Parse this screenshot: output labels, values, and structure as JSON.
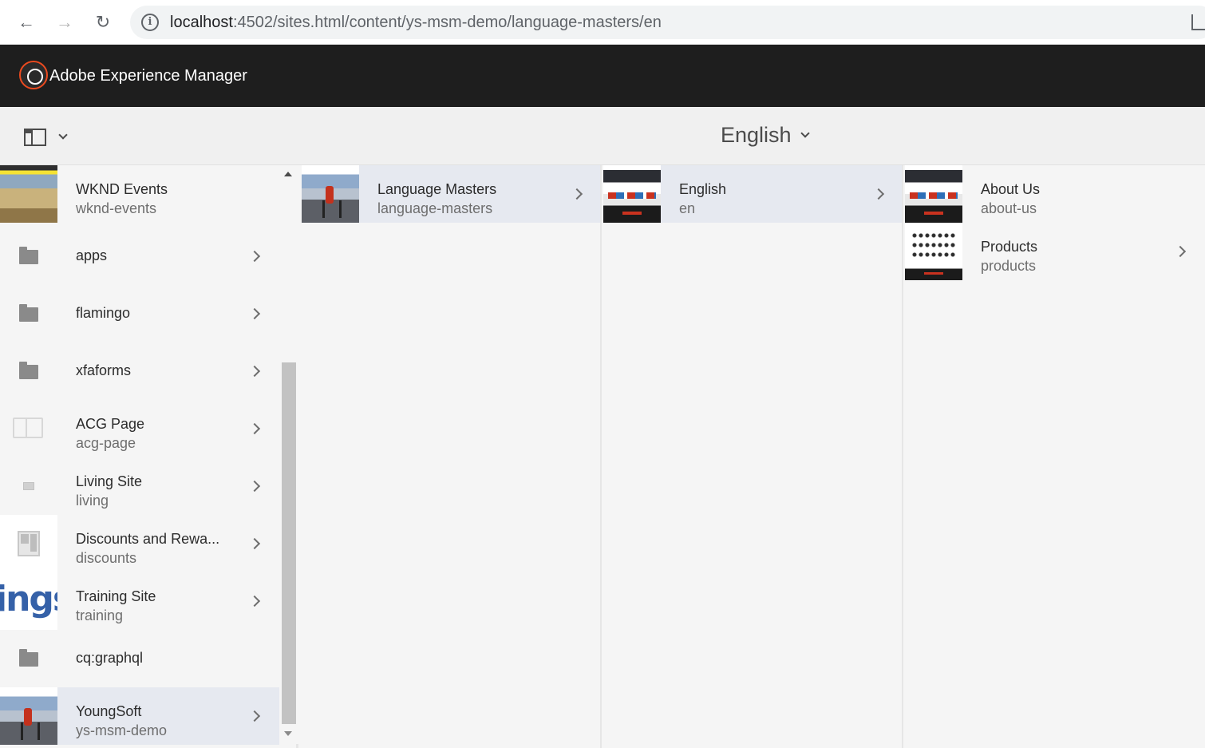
{
  "browser": {
    "back_icon": "arrow-left-icon",
    "forward_icon": "arrow-right-icon",
    "reload_icon": "reload-icon",
    "url_host": "localhost",
    "url_path": ":4502/sites.html/content/ys-msm-demo/language-masters/en"
  },
  "header": {
    "app_title": "Adobe Experience Manager"
  },
  "toolbar": {
    "title": "English"
  },
  "columns": [
    {
      "items": [
        {
          "title": "WKND Events",
          "name": "wknd-events"
        },
        {
          "title": "apps",
          "name": ""
        },
        {
          "title": "flamingo",
          "name": ""
        },
        {
          "title": "xfaforms",
          "name": ""
        },
        {
          "title": "ACG Page",
          "name": "acg-page"
        },
        {
          "title": "Living Site",
          "name": "living"
        },
        {
          "title": "Discounts and Rewa...",
          "name": "discounts"
        },
        {
          "title": "Training Site",
          "name": "training",
          "thumb_text": "ings"
        },
        {
          "title": "cq:graphql",
          "name": ""
        },
        {
          "title": "YoungSoft",
          "name": "ys-msm-demo"
        }
      ]
    },
    {
      "items": [
        {
          "title": "Language Masters",
          "name": "language-masters"
        }
      ]
    },
    {
      "items": [
        {
          "title": "English",
          "name": "en"
        }
      ]
    },
    {
      "items": [
        {
          "title": "About Us",
          "name": "about-us"
        },
        {
          "title": "Products",
          "name": "products"
        }
      ]
    }
  ],
  "colors": {
    "header_bg": "#1e1e1e",
    "selected_bg": "#e6e9f0",
    "brand_accent": "#eb4a1f"
  }
}
